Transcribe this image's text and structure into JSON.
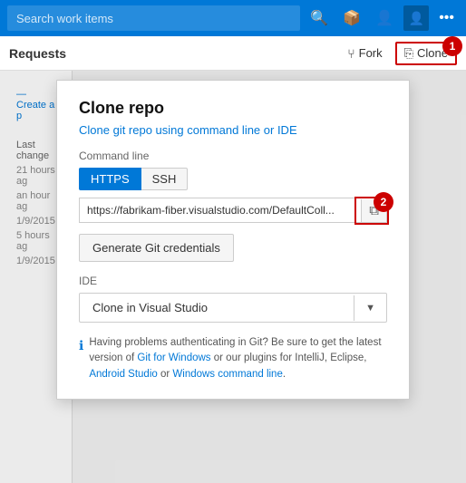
{
  "topbar": {
    "search_placeholder": "Search work items",
    "icons": [
      "search",
      "inbox",
      "people",
      "avatar",
      "more"
    ]
  },
  "subbar": {
    "title": "Requests",
    "fork_label": "Fork",
    "clone_label": "Clone",
    "badge1": "1"
  },
  "left_panel": {
    "create_link": "Create a p",
    "last_change": "Last change",
    "dates": [
      "21 hours ag",
      "an hour ag",
      "1/9/2015",
      "5 hours ag",
      "1/9/2015"
    ]
  },
  "modal": {
    "title": "Clone repo",
    "subtitle": "Clone git repo using command line or IDE",
    "command_section": "Command line",
    "tabs": [
      "HTTPS",
      "SSH"
    ],
    "active_tab": "HTTPS",
    "url": "https://fabrikam-fiber.visualstudio.com/DefaultColl...",
    "copy_tooltip": "Copy",
    "generate_creds_label": "Generate Git credentials",
    "ide_section": "IDE",
    "clone_vs_label": "Clone in Visual Studio",
    "badge2": "2",
    "info_text_before": "Having problems authenticating in Git? Be sure to get the latest version of ",
    "info_link1": "Git for Windows",
    "info_text_mid": " or our plugins for IntelliJ, Eclipse, ",
    "info_link2": "Android Studio",
    "info_text_after": " or ",
    "info_link3": "Windows command line",
    "info_text_end": "."
  }
}
